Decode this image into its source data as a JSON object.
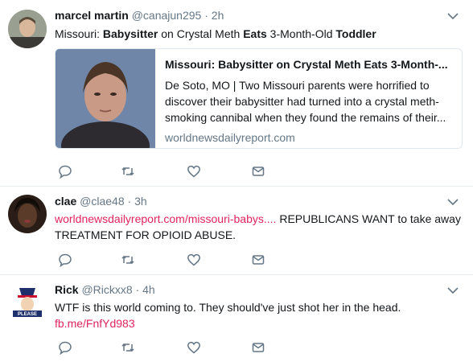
{
  "tweets": [
    {
      "name": "marcel martin",
      "handle": "@canajun295",
      "sep": "·",
      "time": "2h",
      "text_parts": [
        "Missouri: ",
        "Babysitter",
        " on Crystal Meth ",
        "Eats",
        " 3-Month-Old ",
        "Toddler"
      ],
      "card": {
        "title": "Missouri: Babysitter on Crystal Meth Eats 3-Month-...",
        "description": "De Soto, MO | Two Missouri parents were horrified to discover their babysitter had turned into a crystal meth-smoking cannibal when they found the remains of their...",
        "domain": "worldnewsdailyreport.com"
      }
    },
    {
      "name": "clae",
      "handle": "@clae48",
      "sep": "·",
      "time": "3h",
      "link": "worldnewsdailyreport.com/missouri-babys....",
      "text": " REPUBLICANS WANT to take away TREATMENT FOR OPIOID ABUSE."
    },
    {
      "name": "Rick",
      "handle": "@Rickxx8",
      "sep": "·",
      "time": "4h",
      "text": "WTF is this world coming to.  They should've just shot her in the head.",
      "link": "fb.me/FnfYd983",
      "avatar_text": "PLEASE"
    }
  ],
  "icons": [
    "reply-icon",
    "retweet-icon",
    "like-icon",
    "dm-icon",
    "chevron-down-icon"
  ],
  "colors": {
    "link": "#e0245e",
    "muted": "#657786",
    "icon": "#657786",
    "border": "#e6ecf0"
  }
}
